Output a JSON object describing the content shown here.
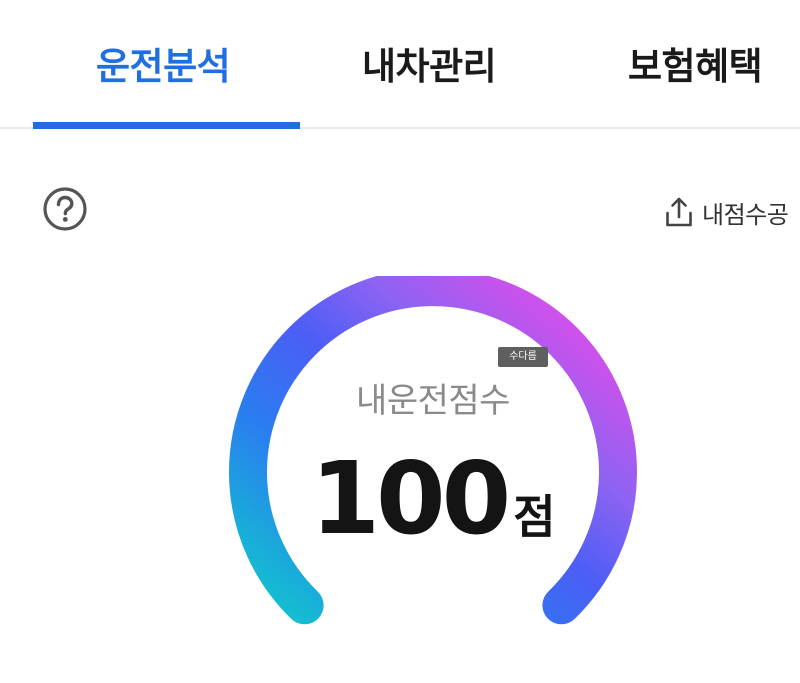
{
  "tabs": [
    {
      "label": "운전분석",
      "active": true
    },
    {
      "label": "내차관리",
      "active": false
    },
    {
      "label": "보험혜택",
      "active": false
    }
  ],
  "toolbar": {
    "help_icon": "question-circle-icon",
    "share_icon": "share-upload-icon",
    "share_label": "내점수공"
  },
  "gauge": {
    "label": "내운전점수",
    "score": "100",
    "unit": "점",
    "level": 1.0,
    "gradient_colors": [
      "#10c8cc",
      "#2a7df0",
      "#4b5ef5",
      "#8e63f2",
      "#c653ec",
      "#ee4fe6"
    ]
  },
  "overlay": {
    "badge_text": "수다름"
  },
  "colors": {
    "accent": "#1f6fe0",
    "text_dark": "#1a1a1a",
    "text_muted": "#8a8a8a"
  }
}
